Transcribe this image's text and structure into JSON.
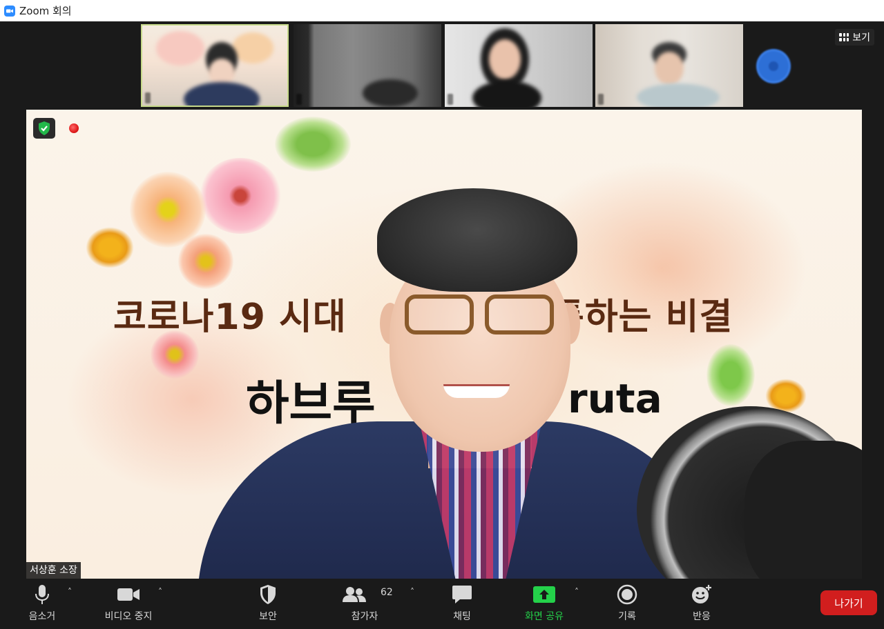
{
  "window": {
    "title": "Zoom 회의"
  },
  "gallery": {
    "view_label": "보기",
    "participants": [
      {
        "name": ""
      },
      {
        "name": ""
      },
      {
        "name": ""
      },
      {
        "name": ""
      }
    ]
  },
  "main_video": {
    "slide_title": "코로나19 시대",
    "slide_title_right": "통하는 비결",
    "slide_subtitle": "하브루",
    "slide_subtitle_right": "ruta",
    "speaker_name": "서상훈 소장"
  },
  "toolbar": {
    "mute_label": "음소거",
    "video_label": "비디오 중지",
    "security_label": "보안",
    "participants_label": "참가자",
    "participants_count": "62",
    "chat_label": "채팅",
    "share_label": "화면 공유",
    "record_label": "기록",
    "reactions_label": "반응",
    "leave_label": "나가기",
    "share_color": "#24d14a",
    "leave_color": "#d11e1e"
  }
}
